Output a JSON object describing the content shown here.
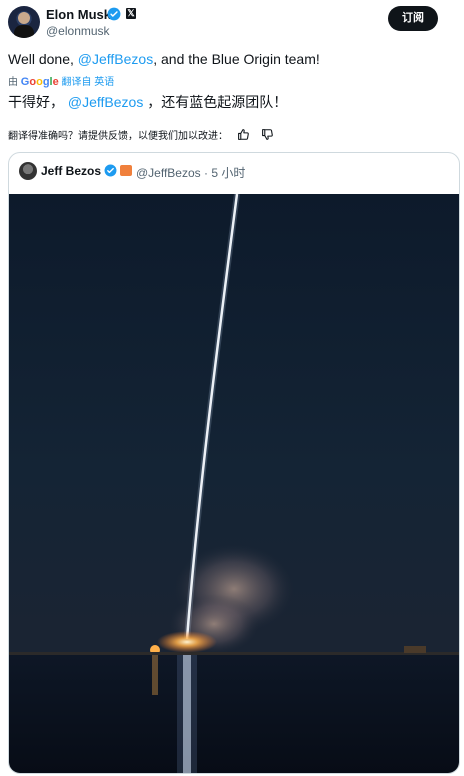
{
  "author": {
    "name": "Elon Musk",
    "handle": "@elonmusk",
    "x_badge": "𝕏"
  },
  "subscribe_label": "订阅",
  "tweet": {
    "prefix": "Well done, ",
    "mention": "@JeffBezos",
    "suffix": ", and the Blue Origin team!"
  },
  "translation": {
    "by": "由",
    "google": [
      "G",
      "o",
      "o",
      "g",
      "l",
      "e"
    ],
    "translated_from": "翻译自 英语",
    "prefix": "干得好，",
    "mention": "@JeffBezos",
    "suffix": "，还有蓝色起源团队！"
  },
  "feedback": {
    "question": "翻译得准确吗？请提供反馈，以便我们加以改进："
  },
  "quoted": {
    "name": "Jeff Bezos",
    "meta": "@JeffBezos · 5 小时"
  },
  "colors": {
    "accent": "#1d9bf0",
    "verified": "#1d9bf0",
    "text": "#0f1419",
    "muted": "#536471"
  },
  "icons": [
    "verified-badge-icon",
    "x-logo-icon",
    "thumbs-up-icon",
    "thumbs-down-icon",
    "affiliate-badge-icon"
  ]
}
